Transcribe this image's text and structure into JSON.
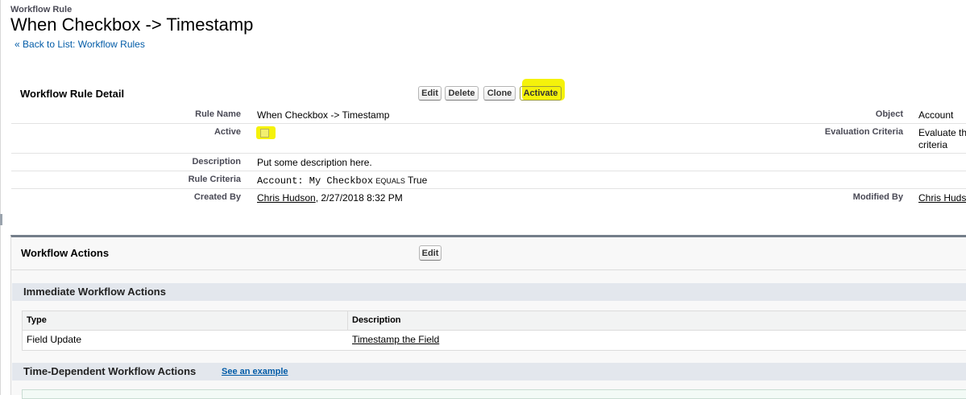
{
  "header": {
    "page_type": "Workflow Rule",
    "title": "When Checkbox -> Timestamp",
    "back_prefix": "«",
    "back_link": "Back to List: Workflow Rules"
  },
  "detail": {
    "section_title": "Workflow Rule Detail",
    "buttons": {
      "edit": "Edit",
      "delete": "Delete",
      "clone": "Clone",
      "activate": "Activate"
    },
    "fields": {
      "rule_name_label": "Rule Name",
      "rule_name_value": "When Checkbox -> Timestamp",
      "object_label": "Object",
      "object_value": "Account",
      "active_label": "Active",
      "active_checked": false,
      "eval_label": "Evaluation Criteria",
      "eval_value_line1": "Evaluate th",
      "eval_value_line2": "criteria",
      "description_label": "Description",
      "description_value": "Put some description here.",
      "rule_criteria_label": "Rule Criteria",
      "criteria_field": "Account: My Checkbox",
      "criteria_operator": "EQUALS",
      "criteria_value": "True",
      "created_by_label": "Created By",
      "created_by_user": "Chris Hudson",
      "created_by_date": ", 2/27/2018 8:32 PM",
      "modified_by_label": "Modified By",
      "modified_by_user": "Chris Huds"
    }
  },
  "actions": {
    "section_title": "Workflow Actions",
    "edit_button": "Edit",
    "immediate": {
      "title": "Immediate Workflow Actions",
      "columns": [
        "Type",
        "Description"
      ],
      "rows": [
        {
          "type": "Field Update",
          "description": "Timestamp the Field"
        }
      ]
    },
    "time_dependent": {
      "title": "Time-Dependent Workflow Actions",
      "example_link": "See an example"
    }
  },
  "colors": {
    "highlight": "#f5f20a",
    "link": "#015ba7",
    "section_border": "#747e8a"
  }
}
